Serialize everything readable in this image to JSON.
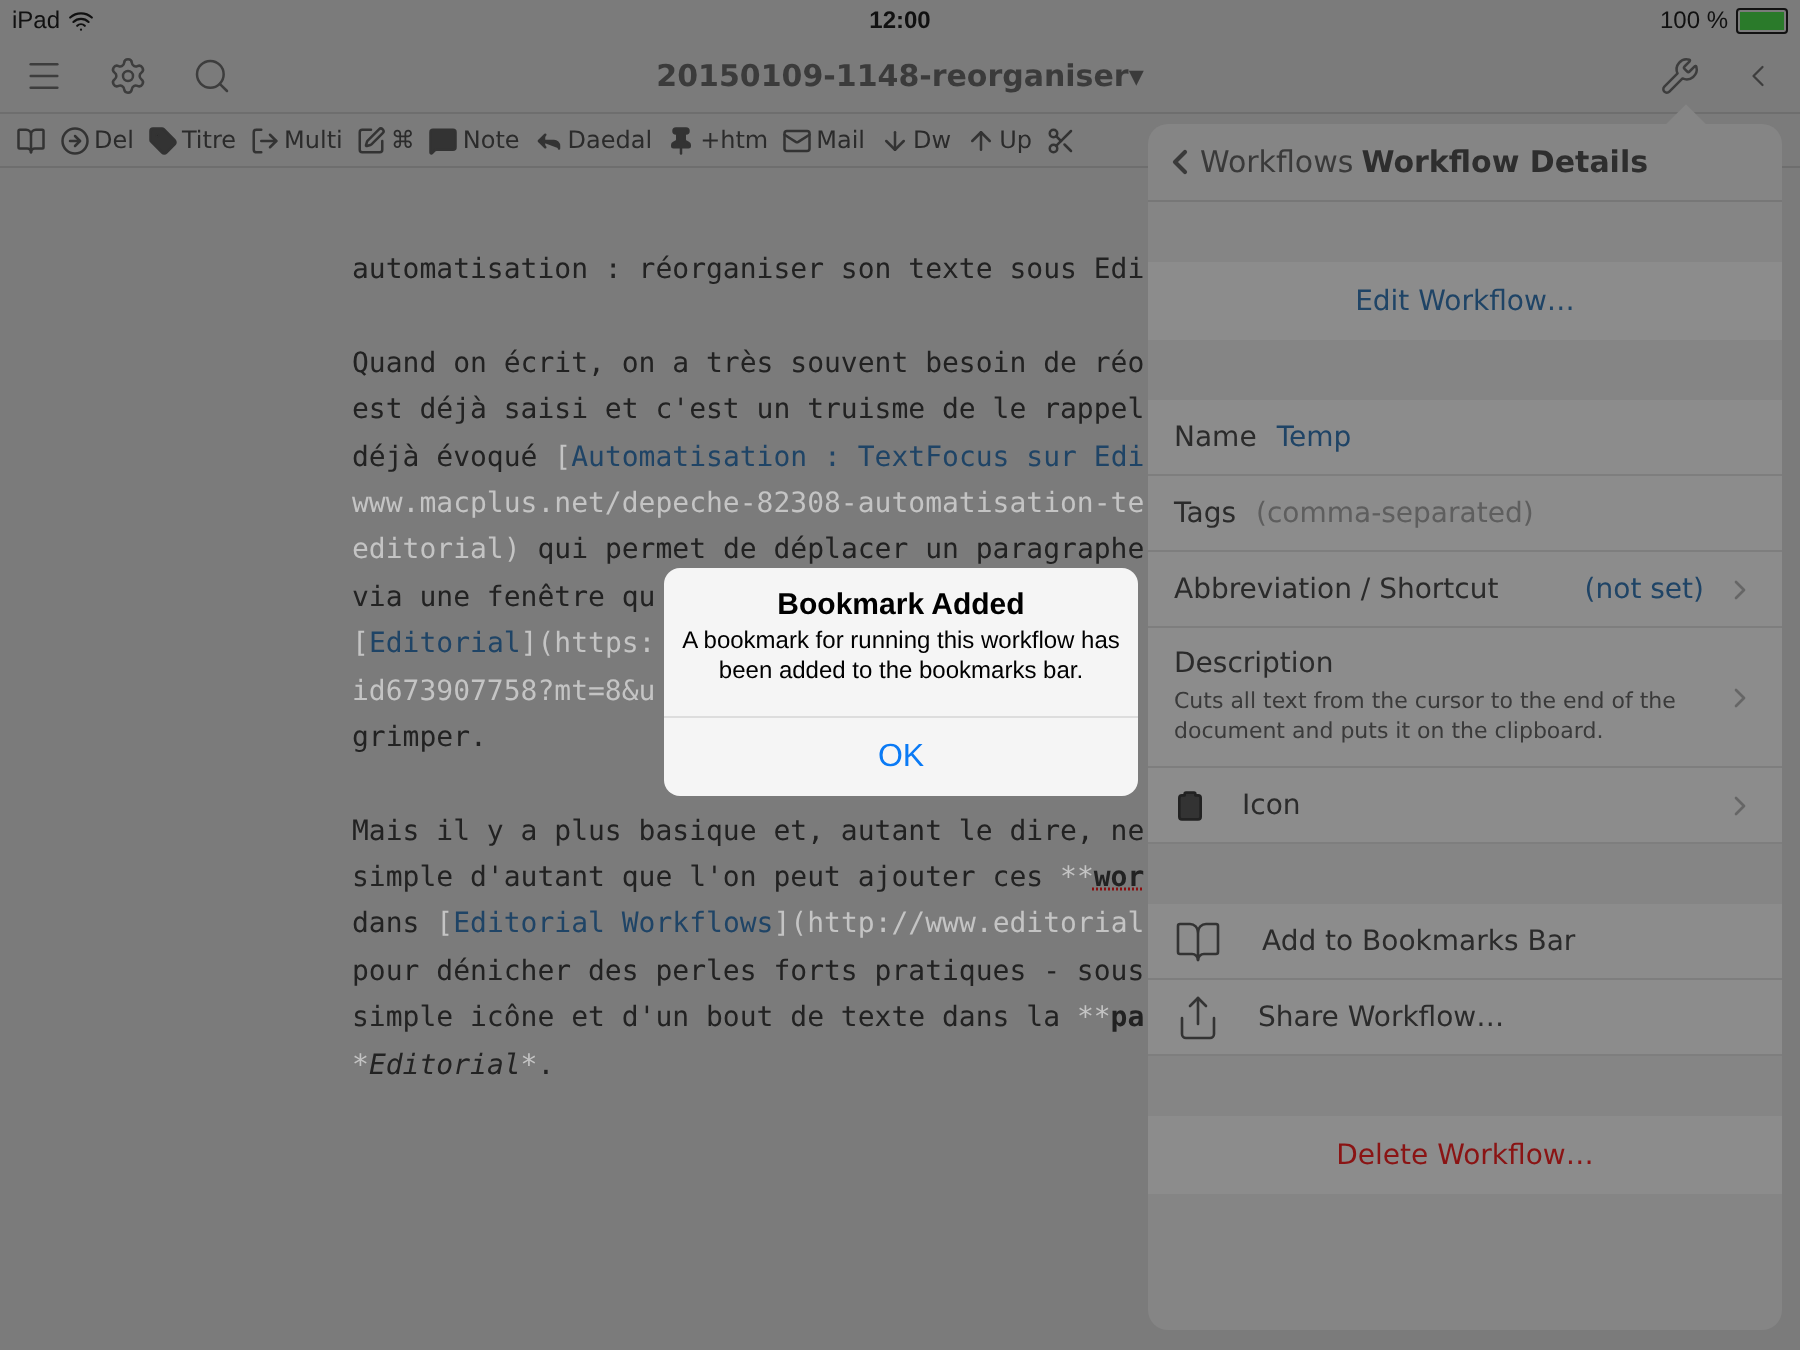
{
  "status_bar": {
    "device": "iPad",
    "time": "12:00",
    "battery": "100 %"
  },
  "nav_bar": {
    "title": "20150109-1148-reorganiser",
    "caret": "▾"
  },
  "toolbar": {
    "items": [
      {
        "kind": "icon_only"
      },
      {
        "kind": "labeled",
        "label": "Del"
      },
      {
        "kind": "labeled",
        "label": "Titre"
      },
      {
        "kind": "labeled",
        "label": "Multi"
      },
      {
        "kind": "labeled",
        "label": "⌘"
      },
      {
        "kind": "labeled",
        "label": "Note"
      },
      {
        "kind": "labeled",
        "label": "Daedal"
      },
      {
        "kind": "labeled",
        "label": "+htm"
      },
      {
        "kind": "labeled",
        "label": "Mail"
      },
      {
        "kind": "labeled",
        "label": "Dw"
      },
      {
        "kind": "labeled",
        "label": "Up"
      },
      {
        "kind": "icon_only"
      }
    ]
  },
  "editor": {
    "paragraphs": [
      [
        [
          {
            "kind": "plain",
            "text": "automatisation : réorganiser son texte sous Edi"
          }
        ]
      ],
      [
        [
          {
            "kind": "plain",
            "text": "Quand on écrit, on a très souvent besoin de réo"
          }
        ],
        [
          {
            "kind": "plain",
            "text": "est déjà saisi et c'est un truisme de le rappel"
          }
        ],
        [
          {
            "kind": "plain",
            "text": "déjà évoqué "
          },
          {
            "kind": "faint",
            "text": "["
          },
          {
            "kind": "link",
            "text": "Automatisation : TextFocus sur Edi"
          }
        ],
        [
          {
            "kind": "faint",
            "text": "www.macplus.net/depeche-82308-automatisation-te"
          }
        ],
        [
          {
            "kind": "faint",
            "text": "editorial)"
          },
          {
            "kind": "plain",
            "text": " qui permet de déplacer un paragraphe"
          }
        ],
        [
          {
            "kind": "plain",
            "text": "via une fenêtre qu"
          }
        ],
        [
          {
            "kind": "faint",
            "text": "["
          },
          {
            "kind": "link",
            "text": "Editorial"
          },
          {
            "kind": "faint",
            "text": "](https:"
          }
        ],
        [
          {
            "kind": "faint",
            "text": "id673907758?mt=8&u"
          }
        ],
        [
          {
            "kind": "plain",
            "text": "grimper."
          }
        ]
      ],
      [
        [
          {
            "kind": "plain",
            "text": "Mais il y a plus basique et, autant le dire, ne"
          }
        ],
        [
          {
            "kind": "plain",
            "text": "simple d'autant que l'on peut ajouter ces "
          },
          {
            "kind": "faint",
            "text": "**"
          },
          {
            "kind": "bold",
            "text": "wor",
            "misspelled": true
          }
        ],
        [
          {
            "kind": "plain",
            "text": "dans "
          },
          {
            "kind": "faint",
            "text": "["
          },
          {
            "kind": "link",
            "text": "Editorial Workflows"
          },
          {
            "kind": "faint",
            "text": "](http://www.editorial"
          }
        ],
        [
          {
            "kind": "plain",
            "text": "pour dénicher des perles forts pratiques - sous"
          }
        ],
        [
          {
            "kind": "plain",
            "text": "simple icône et d'un bout de texte dans la "
          },
          {
            "kind": "faint",
            "text": "**"
          },
          {
            "kind": "bold",
            "text": "pa"
          }
        ],
        [
          {
            "kind": "faint",
            "text": "*"
          },
          {
            "kind": "italic",
            "text": "Editorial"
          },
          {
            "kind": "faint",
            "text": "*"
          },
          {
            "kind": "plain",
            "text": "."
          }
        ]
      ]
    ]
  },
  "panel": {
    "back": "Workflows",
    "title": "Workflow Details",
    "edit_button": "Edit Workflow…",
    "name": {
      "label": "Name",
      "value": "Temp"
    },
    "tags": {
      "label": "Tags",
      "placeholder": "(comma-separated)"
    },
    "abbreviation": {
      "label": "Abbreviation / Shortcut",
      "value": "(not set)"
    },
    "description": {
      "label": "Description",
      "text": "Cuts all text from the cursor to the end of the document and puts it on the clipboard."
    },
    "icon_row": {
      "label": "Icon"
    },
    "actions": [
      {
        "label": "Add to Bookmarks Bar"
      },
      {
        "label": "Share Workflow…"
      }
    ],
    "delete_button": "Delete Workflow…"
  },
  "alert": {
    "title": "Bookmark Added",
    "message": "A bookmark for running this workflow has been added to the bookmarks bar.",
    "button": "OK"
  }
}
